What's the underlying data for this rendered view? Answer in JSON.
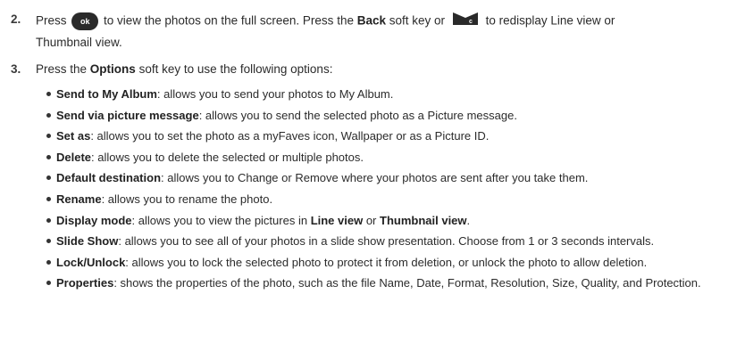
{
  "steps": [
    {
      "number": "2.",
      "part1": "Press",
      "ok_icon_label": "ok",
      "part2": "to view the photos on the full screen. Press the",
      "back_label": "Back",
      "part3": "soft key or",
      "part4": "to redisplay Line view or",
      "line2": "Thumbnail view."
    },
    {
      "number": "3.",
      "part1": "Press the",
      "options_label": "Options",
      "part2": "soft key to use the following options:"
    }
  ],
  "icons": {
    "ok": "ok-button-icon",
    "back": "back-end-key-icon"
  },
  "options": [
    {
      "term": "Send to My Album",
      "desc": ": allows you to send your photos to My Album."
    },
    {
      "term": "Send via picture message",
      "desc": ": allows you to send the selected photo as a Picture message."
    },
    {
      "term": "Set as",
      "desc": ": allows you to set the photo as a myFaves icon, Wallpaper or as a Picture ID."
    },
    {
      "term": "Delete",
      "desc": ": allows you to delete the selected or multiple photos."
    },
    {
      "term": "Default destination",
      "desc": ": allows you to Change or Remove where your photos are sent after you take them."
    },
    {
      "term": "Rename",
      "desc": ": allows you to rename the photo."
    },
    {
      "term": "Display mode",
      "desc": ": allows you to view the pictures in ",
      "term2": "Line view",
      "mid": " or ",
      "term3": "Thumbnail view",
      "end": "."
    },
    {
      "term": "Slide Show",
      "desc": ": allows you to see all of your photos in a slide show presentation. Choose from 1 or 3 seconds intervals."
    },
    {
      "term": "Lock/Unlock",
      "desc": ": allows you to lock the selected photo to protect it from deletion, or unlock the photo to allow deletion."
    },
    {
      "term": "Properties",
      "desc": ": shows the properties of the photo, such as the file Name, Date, Format, Resolution, Size, Quality, and Protection."
    }
  ]
}
